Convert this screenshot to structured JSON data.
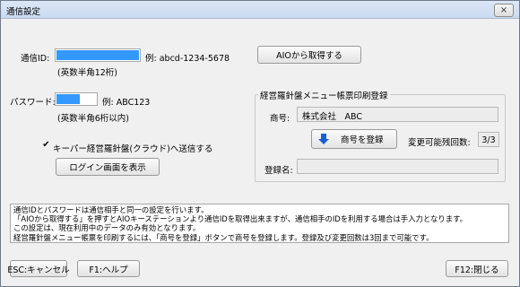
{
  "window": {
    "title": "通信設定",
    "close_symbol": "×"
  },
  "comm_id": {
    "label": "通信ID:",
    "example": "例: abcd-1234-5678",
    "hint": "(英数半角12桁)"
  },
  "password": {
    "label": "パスワード:",
    "example": "例: ABC123",
    "hint": "(英数半角6桁以内)"
  },
  "buttons": {
    "aio_fetch": "AIOから取得する",
    "login_screen": "ログイン画面を表示",
    "register_name": "商号を登録",
    "esc_cancel": "ESC:キャンセル",
    "f1_help": "F1:ヘルプ",
    "f12_close": "F12:閉じる"
  },
  "cloud_send": {
    "label": "キーパー経営羅針盤(クラウド)へ送信する",
    "checked": true,
    "mark": "✔"
  },
  "menu_group": {
    "title": "経営羅針盤メニュー帳票印刷登録",
    "trade_name_label": "商号:",
    "trade_name_value": "株式会社　ABC",
    "remaining_label": "変更可能残回数:",
    "remaining_value": "3/3",
    "registered_name_label": "登録名:",
    "registered_name_value": ""
  },
  "info_lines": [
    "通信IDとパスワードは通信相手と同一の設定を行います。",
    "「AIOから取得する」を押すとAIOキーステーションより通信IDを取得出来ますが、通信相手のIDを利用する場合は手入力となります。",
    "この設定は、現在利用中のデータのみ有効となります。",
    "経営羅針盤メニュー帳票を印刷するには、「商号を登録」ボタンで商号を登録します。登録及び変更回数は3回まで可能です。"
  ],
  "colors": {
    "selection": "#3399ff",
    "arrow": "#1a5fd0"
  },
  "icons": {
    "register_arrow": "arrow-down-icon",
    "close": "close-icon",
    "check": "checkmark-icon"
  }
}
